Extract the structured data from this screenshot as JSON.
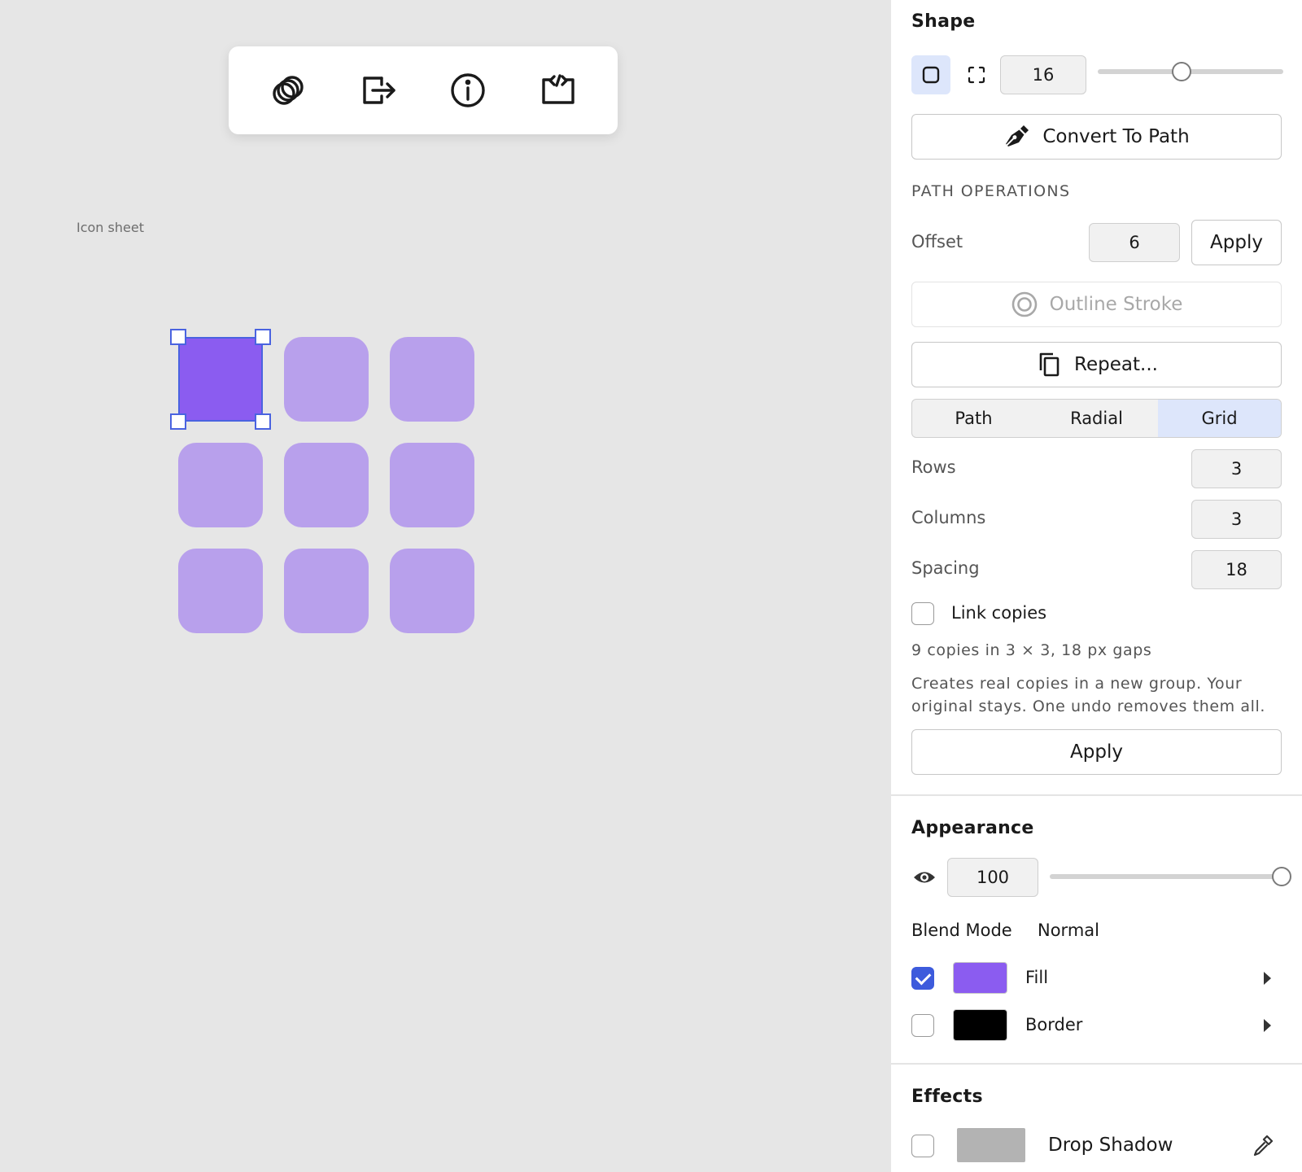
{
  "toolbar": {
    "items": [
      {
        "name": "overlap-circles-icon"
      },
      {
        "name": "export-icon"
      },
      {
        "name": "info-icon"
      },
      {
        "name": "code-embed-icon"
      }
    ]
  },
  "canvas": {
    "sheet_label": "Icon sheet",
    "tile_color": "#b8a0ec",
    "selected_color": "#8b5cf0",
    "tiles": [
      {
        "row": 1,
        "col": 1,
        "selected": true
      },
      {
        "row": 1,
        "col": 2,
        "selected": false
      },
      {
        "row": 1,
        "col": 3,
        "selected": false
      },
      {
        "row": 2,
        "col": 1,
        "selected": false
      },
      {
        "row": 2,
        "col": 2,
        "selected": false
      },
      {
        "row": 2,
        "col": 3,
        "selected": false
      },
      {
        "row": 3,
        "col": 1,
        "selected": false
      },
      {
        "row": 3,
        "col": 2,
        "selected": false
      },
      {
        "row": 3,
        "col": 3,
        "selected": false
      }
    ]
  },
  "shape": {
    "title": "Shape",
    "corner_radius": "16",
    "radius_slider_fraction": 0.45,
    "convert_to_path": "Convert To Path"
  },
  "path_ops": {
    "caption": "PATH OPERATIONS",
    "offset_label": "Offset",
    "offset_value": "6",
    "offset_apply": "Apply",
    "outline_stroke": "Outline Stroke",
    "repeat": "Repeat..."
  },
  "repeat": {
    "tabs": [
      {
        "label": "Path",
        "active": false
      },
      {
        "label": "Radial",
        "active": false
      },
      {
        "label": "Grid",
        "active": true
      }
    ],
    "rows_label": "Rows",
    "rows_value": "3",
    "columns_label": "Columns",
    "columns_value": "3",
    "spacing_label": "Spacing",
    "spacing_value": "18",
    "link_copies_label": "Link copies",
    "link_copies_checked": false,
    "summary": "9 copies in 3 × 3, 18 px gaps",
    "help_line1": "Creates real copies in a new group. Your",
    "help_line2": "original stays. One undo removes them all.",
    "apply": "Apply"
  },
  "appearance": {
    "title": "Appearance",
    "opacity_value": "100",
    "opacity_fraction": 1.0,
    "blend_label": "Blend Mode",
    "blend_value": "Normal",
    "fill_label": "Fill",
    "fill_checked": true,
    "fill_color": "#8b5cf0",
    "border_label": "Border",
    "border_checked": false,
    "border_color": "#000000"
  },
  "effects": {
    "title": "Effects",
    "drop_shadow_label": "Drop Shadow",
    "drop_shadow_checked": false,
    "drop_shadow_color": "#b3b3b3"
  }
}
